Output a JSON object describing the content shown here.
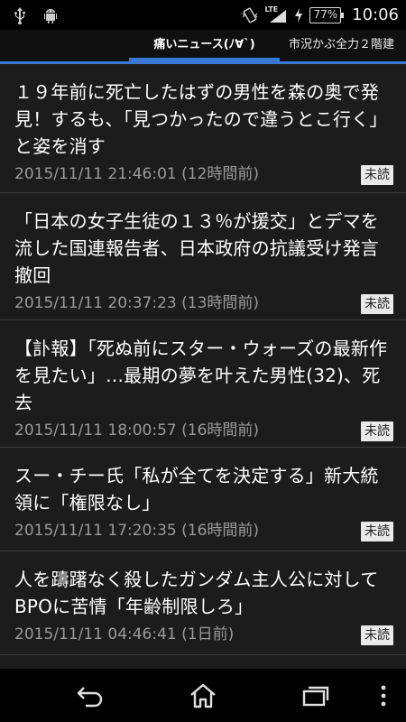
{
  "status_bar": {
    "network": "LTE",
    "battery": "77%",
    "time": "10:06",
    "icons": [
      "usb-icon",
      "android-icon",
      "vibrate-icon",
      "signal-icon",
      "charging-icon"
    ]
  },
  "tabs": {
    "active": "痛いニュース(ﾉ∀`)",
    "next": "市況かぶ全力２階建"
  },
  "news": [
    {
      "title": "１９年前に死亡したはずの男性を森の奥で発見！するも、「見つかったので違うとこ行く」と姿を消す",
      "date": "2015/11/11 21:46:01 (12時間前)",
      "badge": "未読"
    },
    {
      "title": "「日本の女子生徒の１３％が援交」とデマを流した国連報告者、日本政府の抗議受け発言撤回",
      "date": "2015/11/11 20:37:23 (13時間前)",
      "badge": "未読"
    },
    {
      "title": "【訃報】「死ぬ前にスター・ウォーズの最新作を見たい」…最期の夢を叶えた男性(32)、死去",
      "date": "2015/11/11 18:00:57 (16時間前)",
      "badge": "未読"
    },
    {
      "title": "スー・チー氏「私が全てを決定する」新大統領に「権限なし」",
      "date": "2015/11/11 17:20:35 (16時間前)",
      "badge": "未読"
    },
    {
      "title": "人を躊躇なく殺したガンダム主人公に対してBPOに苦情「年齢制限しろ」",
      "date": "2015/11/11 04:46:41 (1日前)",
      "badge": "未読"
    }
  ],
  "nav": {
    "icons": [
      "back-icon",
      "home-icon",
      "recent-apps-icon",
      "overflow-menu-icon"
    ]
  },
  "colors": {
    "accent": "#3a78d6",
    "background": "#1c1c1c",
    "divider": "#3c3c3c"
  }
}
